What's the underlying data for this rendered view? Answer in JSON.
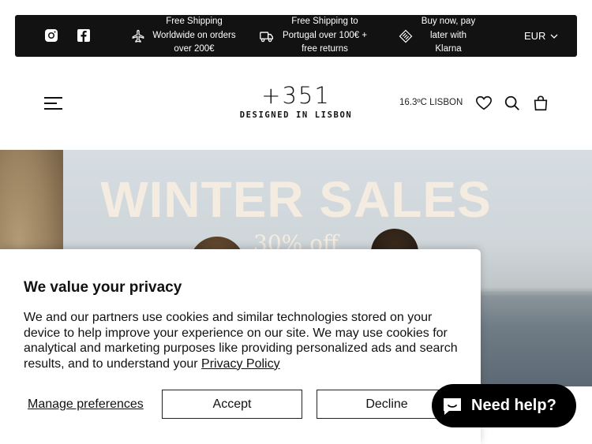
{
  "topbar": {
    "promos": [
      {
        "text": "Free Shipping Worldwide on orders over 200€",
        "icon": "airplane-icon"
      },
      {
        "text": "Free Shipping to Portugal over 100€ + free returns",
        "icon": "delivery-truck-icon"
      },
      {
        "text": "Buy now, pay later with Klarna",
        "icon": "klarna-icon"
      }
    ],
    "currency": "EUR",
    "social": [
      "instagram-icon",
      "facebook-icon"
    ]
  },
  "header": {
    "logo_main": "+351",
    "logo_tagline": "DESIGNED IN LISBON",
    "weather": "16.3ºC LISBON",
    "icons": [
      "menu-icon",
      "heart-icon",
      "search-icon",
      "bag-icon"
    ]
  },
  "hero": {
    "title": "WINTER SALES",
    "subtitle": "30% off"
  },
  "cookie": {
    "title": "We value your privacy",
    "body": "We and our partners use cookies and similar technologies stored on your device to help improve your experience on our site. We may use cookies for analytical and marketing purposes like providing personalized ads and search results, and to understand your",
    "link": "Privacy Policy",
    "manage": "Manage preferences",
    "accept": "Accept",
    "decline": "Decline"
  },
  "chat": {
    "label": "Need help?"
  },
  "colors": {
    "topbar_bg": "#121212",
    "hero_text": "#f4ebe1",
    "chat_bg": "#000000"
  }
}
